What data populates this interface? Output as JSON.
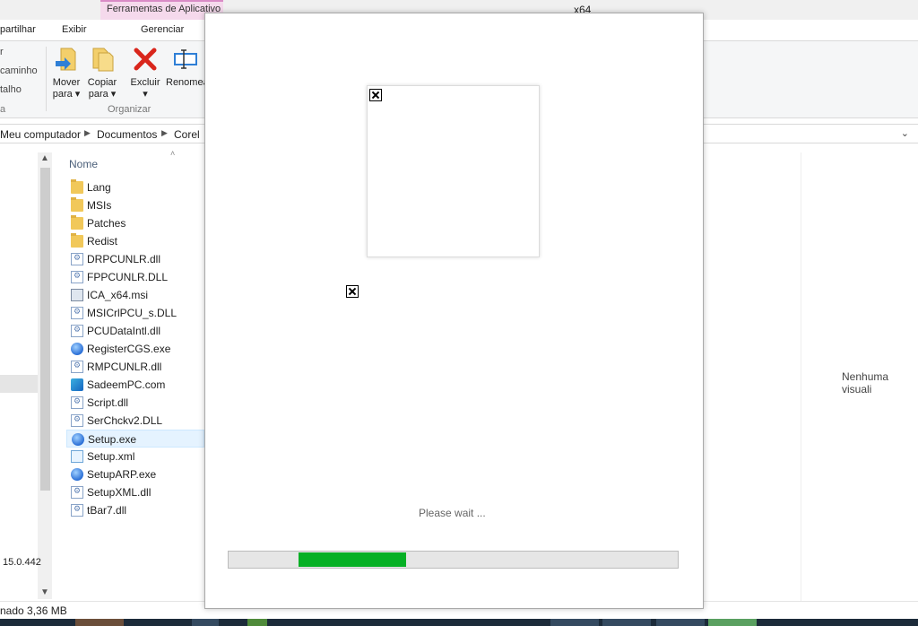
{
  "window": {
    "context_tab": "Ferramentas de Aplicativo",
    "title": "x64"
  },
  "ribbon_tabs": [
    "partilhar",
    "Exibir",
    "Gerenciar"
  ],
  "ribbon": {
    "left_labels": [
      "r",
      "caminho",
      "talho",
      "a"
    ],
    "buttons": [
      {
        "label1": "Mover",
        "label2": "para ▾",
        "icon": "move-to-folder-icon"
      },
      {
        "label1": "Copiar",
        "label2": "para ▾",
        "icon": "copy-to-folder-icon"
      },
      {
        "label1": "Excluir",
        "label2": "▾",
        "icon": "delete-x-icon"
      },
      {
        "label1": "Renomear",
        "label2": "",
        "icon": "rename-icon"
      }
    ],
    "group_label": "Organizar"
  },
  "address": {
    "crumbs": [
      "Meu computador",
      "Documentos",
      "Corel"
    ]
  },
  "filelist": {
    "column_header": "Nome",
    "files": [
      {
        "name": "Lang",
        "type": "folder"
      },
      {
        "name": "MSIs",
        "type": "folder"
      },
      {
        "name": "Patches",
        "type": "folder"
      },
      {
        "name": "Redist",
        "type": "folder"
      },
      {
        "name": "DRPCUNLR.dll",
        "type": "dll"
      },
      {
        "name": "FPPCUNLR.DLL",
        "type": "dll"
      },
      {
        "name": "ICA_x64.msi",
        "type": "msi"
      },
      {
        "name": "MSICrlPCU_s.DLL",
        "type": "dll"
      },
      {
        "name": "PCUDataIntl.dll",
        "type": "dll"
      },
      {
        "name": "RegisterCGS.exe",
        "type": "exe"
      },
      {
        "name": "RMPCUNLR.dll",
        "type": "dll"
      },
      {
        "name": "SadeemPC.com",
        "type": "com"
      },
      {
        "name": "Script.dll",
        "type": "dll"
      },
      {
        "name": "SerChckv2.DLL",
        "type": "dll"
      },
      {
        "name": "Setup.exe",
        "type": "exe",
        "selected": true
      },
      {
        "name": "Setup.xml",
        "type": "xml"
      },
      {
        "name": "SetupARP.exe",
        "type": "exe"
      },
      {
        "name": "SetupXML.dll",
        "type": "dll"
      },
      {
        "name": "tBar7.dll",
        "type": "dll"
      }
    ]
  },
  "nav": {
    "size_label": "15.0.442"
  },
  "preview": {
    "text": "Nenhuma visuali"
  },
  "status": {
    "text": "nado  3,36 MB"
  },
  "dialog": {
    "wait_text": "Please wait ...",
    "progress": {
      "start": 0.155,
      "end": 0.395
    }
  },
  "colors": {
    "progress_fill": "#06b025",
    "context_tab": "#f5d9ec"
  }
}
